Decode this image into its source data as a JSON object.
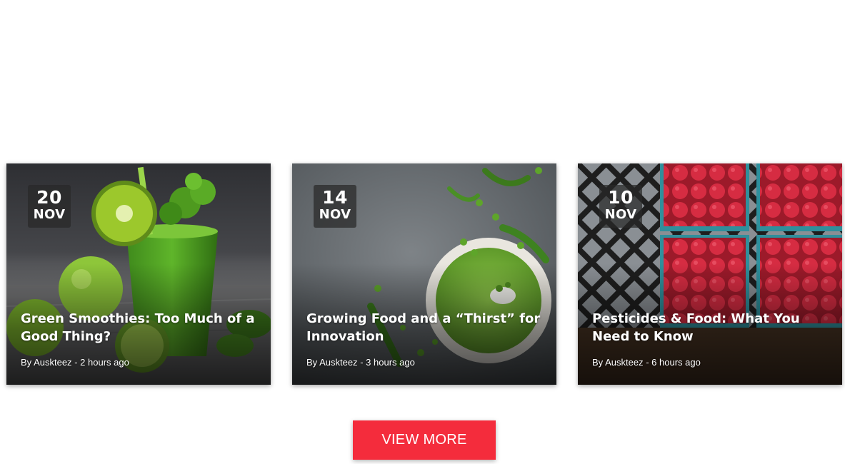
{
  "posts": [
    {
      "day": "20",
      "month": "NOV",
      "title": "Green Smoothies: Too Much of a Good Thing?",
      "by": "By",
      "author": "Auskteez",
      "separator": "-",
      "time": "2 hours ago",
      "image": "green-smoothie-photo"
    },
    {
      "day": "14",
      "month": "NOV",
      "title": "Growing Food and a “Thirst” for Innovation",
      "by": "By",
      "author": "Auskteez",
      "separator": "-",
      "time": "3 hours ago",
      "image": "pea-soup-photo"
    },
    {
      "day": "10",
      "month": "NOV",
      "title": "Pesticides & Food: What You Need to Know",
      "by": "By",
      "author": "Auskteez",
      "separator": "-",
      "time": "6 hours ago",
      "image": "raspberries-photo"
    }
  ],
  "view_more_label": "VIEW MORE",
  "colors": {
    "button": "#f42c3c",
    "badge": "#333333",
    "text": "#ffffff"
  }
}
